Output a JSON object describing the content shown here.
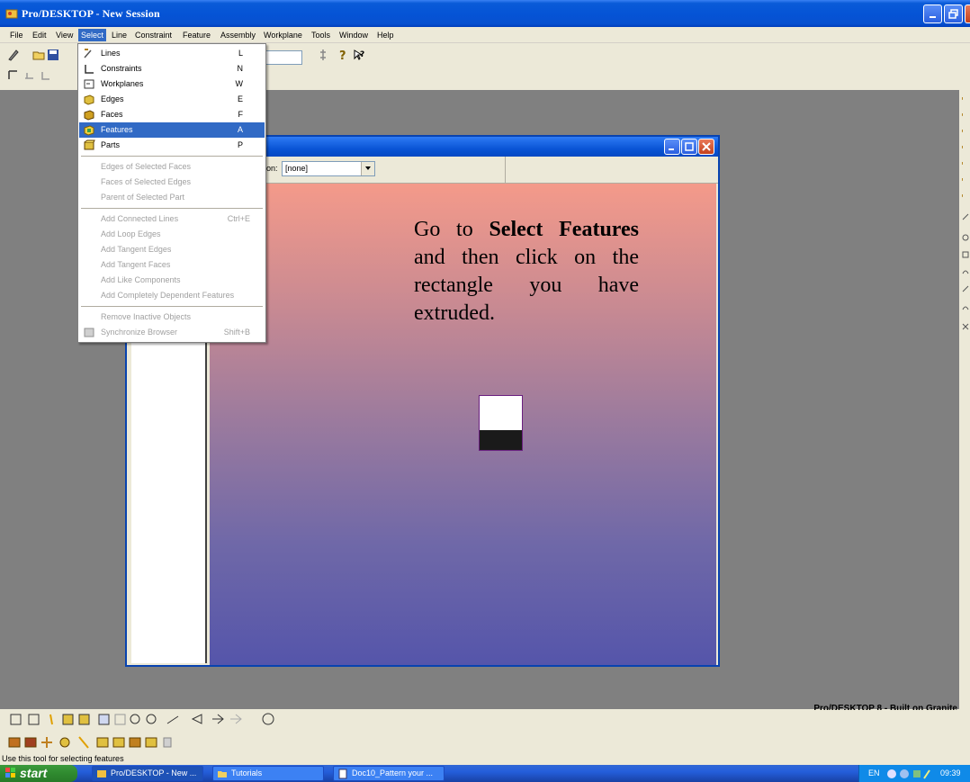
{
  "window": {
    "title": "Pro/DESKTOP - New Session"
  },
  "menubar": {
    "items": [
      "File",
      "Edit",
      "View",
      "Select",
      "Line",
      "Constraint",
      "Feature",
      "Assembly",
      "Workplane",
      "Tools",
      "Window",
      "Help"
    ],
    "active": "Select"
  },
  "select_menu": {
    "items": [
      {
        "label": "Lines",
        "shortcut": "L",
        "state": "normal"
      },
      {
        "label": "Constraints",
        "shortcut": "N",
        "state": "normal"
      },
      {
        "label": "Workplanes",
        "shortcut": "W",
        "state": "normal"
      },
      {
        "label": "Edges",
        "shortcut": "E",
        "state": "normal"
      },
      {
        "label": "Faces",
        "shortcut": "F",
        "state": "normal"
      },
      {
        "label": "Features",
        "shortcut": "A",
        "state": "highlighted"
      },
      {
        "label": "Parts",
        "shortcut": "P",
        "state": "normal"
      },
      {
        "label": "Edges of Selected Faces",
        "shortcut": "",
        "state": "disabled"
      },
      {
        "label": "Faces of Selected Edges",
        "shortcut": "",
        "state": "disabled"
      },
      {
        "label": "Parent of Selected Part",
        "shortcut": "",
        "state": "disabled"
      },
      {
        "label": "Add Connected Lines",
        "shortcut": "Ctrl+E",
        "state": "disabled"
      },
      {
        "label": "Add Loop Edges",
        "shortcut": "",
        "state": "disabled"
      },
      {
        "label": "Add Tangent Edges",
        "shortcut": "",
        "state": "disabled"
      },
      {
        "label": "Add Tangent Faces",
        "shortcut": "",
        "state": "disabled"
      },
      {
        "label": "Add Like Components",
        "shortcut": "",
        "state": "disabled"
      },
      {
        "label": "Add Completely Dependent Features",
        "shortcut": "",
        "state": "disabled"
      },
      {
        "label": "Remove Inactive Objects",
        "shortcut": "",
        "state": "disabled"
      },
      {
        "label": "Synchronize Browser",
        "shortcut": "Shift+B",
        "state": "disabled"
      }
    ]
  },
  "inner_window": {
    "combo_label": "on:",
    "combo_value": "[none]"
  },
  "instruction": {
    "part1": "Go to ",
    "bold1": "Select Features",
    "part2": " and then click on the rectangle you have extruded."
  },
  "brand": "Pro/DESKTOP 8 - Built on Granite",
  "status": "Use this tool for selecting features",
  "taskbar": {
    "start": "start",
    "tasks": [
      "Pro/DESKTOP - New ...",
      "Tutorials",
      "Doc10_Pattern your ..."
    ],
    "lang": "EN",
    "clock": "09:39"
  },
  "colors": {
    "accent": "#316ac5",
    "titlebar": "#0554d6",
    "taskbar": "#245edb",
    "start": "#2f8a2f"
  }
}
